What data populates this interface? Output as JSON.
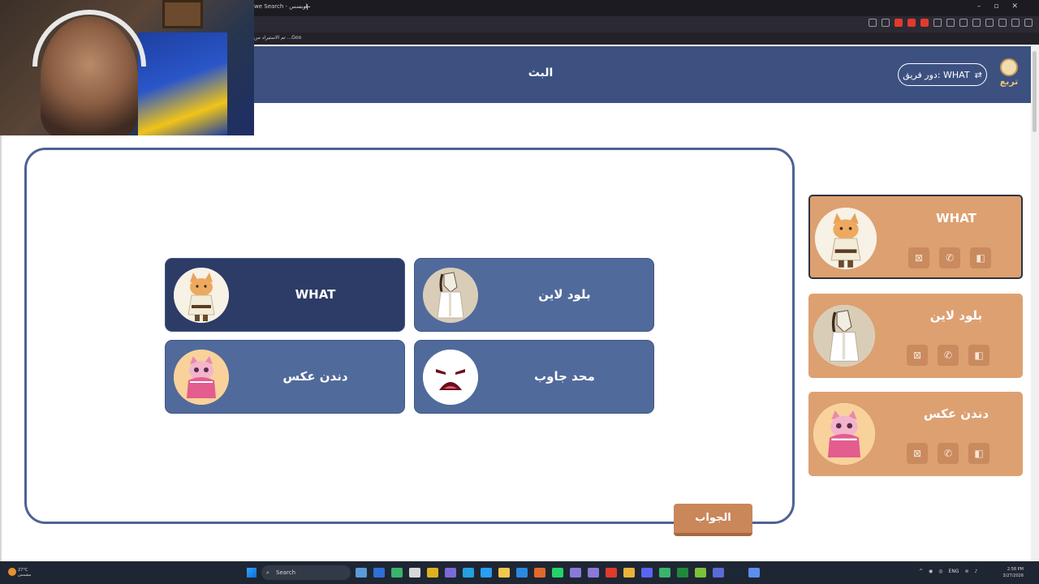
{
  "browser": {
    "tab_title": "we Search - اوبسس",
    "new_tab": "+",
    "window_controls": [
      "–",
      "▫",
      "✕"
    ],
    "notice": "تم الاستيراد من ...Goo"
  },
  "header": {
    "title": "البث",
    "team_turn_label": "دور فريق: WHAT",
    "logo_text": "تربع"
  },
  "options": [
    {
      "label": "WHAT",
      "avatar": "cat-warrior-icon",
      "selected": true
    },
    {
      "label": "بلود لاين",
      "avatar": "horse-icon",
      "selected": false
    },
    {
      "label": "دندن عكس",
      "avatar": "pink-cat-icon",
      "selected": false
    },
    {
      "label": "محد جاوب",
      "avatar": "sad-face-icon",
      "selected": false
    }
  ],
  "answer_button": "الجواب",
  "teams": [
    {
      "name": "WHAT",
      "avatar": "cat-warrior-icon",
      "active": true,
      "tools": [
        "camera-off-icon",
        "phone-icon",
        "split-icon"
      ]
    },
    {
      "name": "بلود لاين",
      "avatar": "horse-icon",
      "active": false,
      "tools": [
        "camera-off-icon",
        "phone-icon",
        "split-icon"
      ]
    },
    {
      "name": "دندن عكس",
      "avatar": "pink-cat-icon",
      "active": false,
      "tools": [
        "camera-off-icon",
        "phone-icon",
        "split-icon"
      ]
    }
  ],
  "taskbar": {
    "weather": "27°C",
    "weather_sub": "مشمس",
    "search": "Search",
    "language": "ENG",
    "time": "2:58 PM",
    "date": "3/27/2026"
  },
  "colors": {
    "header_bg": "#3d5181",
    "option_bg": "#516a9c",
    "option_selected_bg": "#2c3c66",
    "team_card_bg": "#dda071",
    "answer_btn_bg": "#c9875a"
  }
}
